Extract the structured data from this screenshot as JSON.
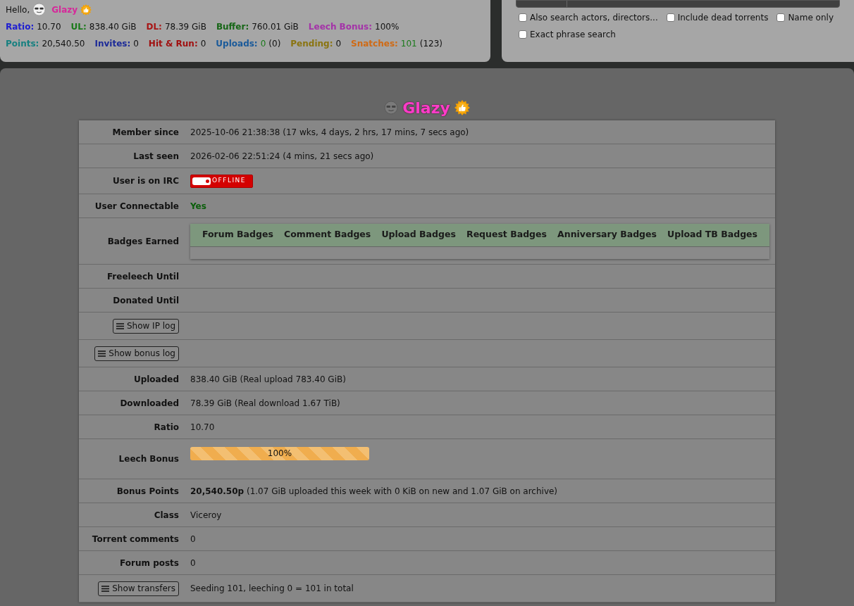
{
  "header": {
    "greeting": "Hello,",
    "username": "Glazy",
    "stats_rows": [
      [
        {
          "label": "Ratio:",
          "color": "#2020d0",
          "value": "10.70"
        },
        {
          "label": "UL:",
          "color": "#1a7a1a",
          "value": "838.40 GiB"
        },
        {
          "label": "DL:",
          "color": "#a81414",
          "value": "78.39 GiB"
        },
        {
          "label": "Buffer:",
          "color": "#166616",
          "value": "760.01 GiB"
        },
        {
          "label": "Leech Bonus:",
          "color": "#a433a8",
          "value": "100%"
        }
      ],
      [
        {
          "label": "Points:",
          "color": "#178080",
          "value": "20,540.50"
        },
        {
          "label": "Invites:",
          "color": "#1c2a98",
          "value": "0"
        },
        {
          "label": "Hit & Run:",
          "color": "#a01010",
          "value": "0"
        },
        {
          "label": "Uploads:",
          "color": "#1a5a9a",
          "count": {
            "text": "0",
            "color": "#1a7a1a"
          },
          "extra": "(0)"
        },
        {
          "label": "Pending:",
          "color": "#8a7410",
          "value": "0"
        },
        {
          "label": "Snatches:",
          "color": "#d06a14",
          "count": {
            "text": "101",
            "color": "#1a7a1a"
          },
          "extra": "(123)"
        }
      ]
    ]
  },
  "search_options": [
    {
      "label": "Also search actors, directors...",
      "checked": false
    },
    {
      "label": "Include dead torrents",
      "checked": false
    },
    {
      "label": "Name only",
      "checked": false
    },
    {
      "label": "Exact phrase search",
      "checked": false
    }
  ],
  "profile": {
    "username": "Glazy",
    "rows": [
      {
        "kind": "text",
        "label": "Member since",
        "value": "2025-10-06 21:38:38 (17 wks, 4 days, 2 hrs, 17 mins, 7 secs ago)"
      },
      {
        "kind": "text",
        "label": "Last seen",
        "value": "2026-02-06 22:51:24 (4 mins, 21 secs ago)"
      },
      {
        "kind": "irc",
        "label": "User is on IRC",
        "value": "OFFLINE"
      },
      {
        "kind": "status",
        "label": "User Connectable",
        "value": "Yes"
      },
      {
        "kind": "badges",
        "label": "Badges Earned",
        "tabs": [
          "Forum Badges",
          "Comment Badges",
          "Upload Badges",
          "Request Badges",
          "Anniversary Badges",
          "Upload TB Badges"
        ]
      },
      {
        "kind": "text",
        "label": "Freeleech Until"
      },
      {
        "kind": "text",
        "label": "Donated Until"
      },
      {
        "kind": "button",
        "label": "Show IP log"
      },
      {
        "kind": "button",
        "label": "Show bonus log"
      },
      {
        "kind": "text",
        "label": "Uploaded",
        "value": "838.40 GiB (Real upload 783.40 GiB)"
      },
      {
        "kind": "text",
        "label": "Downloaded",
        "value": "78.39 GiB (Real download 1.67 TiB)"
      },
      {
        "kind": "text",
        "label": "Ratio",
        "value": "10.70"
      },
      {
        "kind": "progress",
        "label": "Leech Bonus",
        "value": "100%",
        "level": 1
      },
      {
        "kind": "text",
        "label": "Bonus Points",
        "value": "**20,540.50p** (1.07 GiB uploaded this week with 0 KiB on new and 1.07 GiB on archive)"
      },
      {
        "kind": "text",
        "label": "Class",
        "value": "Viceroy"
      },
      {
        "kind": "text",
        "label": "Torrent comments",
        "value": "0"
      },
      {
        "kind": "text",
        "label": "Forum posts",
        "value": "0"
      },
      {
        "kind": "button",
        "label": "Show transfers",
        "value": "Seeding 101, leeching 0 = 101 in total"
      }
    ]
  }
}
